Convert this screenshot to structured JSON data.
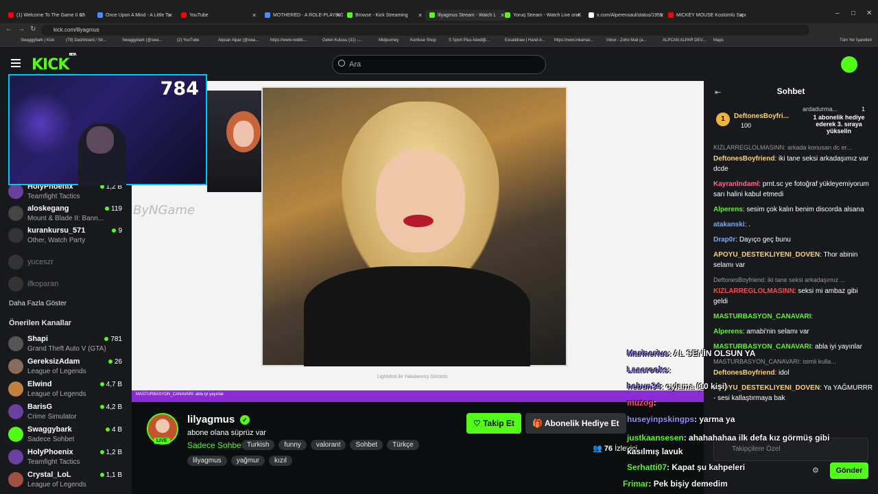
{
  "browser": {
    "tabs": [
      {
        "title": "(1) Welcome To The Game II Ch",
        "color": "#ff0000"
      },
      {
        "title": "Once Upon A Mind - A Little Ta",
        "color": "#4a8cff"
      },
      {
        "title": "YouTube",
        "color": "#ff0000"
      },
      {
        "title": "MOTHERED - A ROLE-PLAYING",
        "color": "#4a8cff"
      },
      {
        "title": "Browse - Kick Streaming",
        "color": "#53fc18"
      },
      {
        "title": "lilyagmus Stream - Watch L",
        "color": "#53fc18"
      },
      {
        "title": "Yoruq Stream - Watch Live on K",
        "color": "#53fc18"
      },
      {
        "title": "x.com/Alperensaul/status/1959",
        "color": "#ffffff"
      },
      {
        "title": "MICKEY MOUSE Kostümlü Sapı",
        "color": "#ff0000"
      }
    ],
    "url": "kick.com/lilyagmus",
    "bookmarks": [
      "Swaggybark | Kick",
      "(79) Dashboard / Str...",
      "Swaggybark (@swa...",
      "(2) YouTube",
      "Alpcan Alpar (@swa...",
      "https://www.reddit....",
      "Gelen Kutusu (31) -...",
      "Midjourney",
      "Konfuse Shop",
      "S Sport Plus-İstediği...",
      "Excalidraw | Hand-d...",
      "https://next.inkamat...",
      "Inbox - Zoho Mail (a...",
      "ALPCAN ALPAR DEV...",
      "Maps",
      "Tüm Yer İşaretleri"
    ]
  },
  "header": {
    "logo": "KICK",
    "logo_sup": "BETA",
    "search_placeholder": "Ara"
  },
  "sidebar": {
    "top_channels": [
      {
        "name": "HolyPhoenix",
        "game": "Teamfight Tactics",
        "viewers": "1,2 B",
        "color": "#6b3fa0"
      },
      {
        "name": "aloskegang",
        "game": "Mount & Blade II: Bann...",
        "viewers": "119",
        "color": "#444"
      },
      {
        "name": "kurankursu_571",
        "game": "Other, Watch Party",
        "viewers": "9",
        "color": "#333"
      }
    ],
    "offline": [
      "yuceszr",
      "ifkoparan"
    ],
    "show_more": "Daha Fazla Göster",
    "recommended_title": "Önerilen Kanallar",
    "recommended": [
      {
        "name": "Shapi",
        "game": "Grand Theft Auto V (GTA)",
        "viewers": "781",
        "color": "#555"
      },
      {
        "name": "GereksizAdam",
        "game": "League of Legends",
        "viewers": "26",
        "color": "#8a6a5a"
      },
      {
        "name": "Elwind",
        "game": "League of Legends",
        "viewers": "4,7 B",
        "color": "#c08040"
      },
      {
        "name": "BarisG",
        "game": "Crime Simulator",
        "viewers": "4,2 B",
        "color": "#6a3fa0"
      },
      {
        "name": "Swaggybark",
        "game": "Sadece Sohbet",
        "viewers": "4 B",
        "color": "#53fc18"
      },
      {
        "name": "HolyPhoenix",
        "game": "Teamfight Tactics",
        "viewers": "1,2 B",
        "color": "#6b3fa0"
      },
      {
        "name": "Crystal_LoL",
        "game": "League of Legends",
        "viewers": "1,1 B",
        "color": "#a05040"
      }
    ]
  },
  "webcam": {
    "count": "784"
  },
  "video": {
    "watermark": "ByNGame",
    "lightshot": "Lightshot ile Yakalanmış Görüntü",
    "purple_bar": "MASTURBASYON_CANAVARI: abla iyi yayınlar"
  },
  "stream": {
    "name": "lilyagmus",
    "title": "abone olana süprüz var",
    "category": "Sadece Sohbet",
    "tags": [
      "Turkish",
      "funny",
      "valorant",
      "Sohbet",
      "Türkçe"
    ],
    "tags2": [
      "lilyagmus",
      "yağmur",
      "kızıl"
    ],
    "follow": "Takip Et",
    "gift_sub": "Abonelik Hediye Et",
    "viewers": "76",
    "viewers_label": "İzleyici",
    "live": "LIVE"
  },
  "chat": {
    "title": "Sohbet",
    "gift": {
      "user": "DeftonesBoyfri...",
      "count": "100",
      "user2": "ardadurma...",
      "count2": "1",
      "text": "1 abonelik hediye ederek 3. sıraya yükselin"
    },
    "messages": [
      {
        "reply": "KIZLARREGLOLMASINN: arkada konusan dc er..."
      },
      {
        "user": "DeftonesBoyfriend",
        "color": "#ffd36a",
        "text": "iki tane seksi arkadaşımız var dcde"
      },
      {
        "user": "Kayranlndaml",
        "color": "#ff6a8a",
        "text": "prnt.sc ye fotoğraf yükleyemiyorum sarı halini kabul etmedi"
      },
      {
        "user": "Alperens",
        "color": "#53fc18",
        "text": "sesim çok kalın benim discorda alsana"
      },
      {
        "user": "atakanski",
        "color": "#7aa8ff",
        "text": "."
      },
      {
        "user": "Drap0r",
        "color": "#7aa8ff",
        "text": "Dayıço geç bunu"
      },
      {
        "user": "APOYU_DESTEKLIYENI_DOVEN",
        "color": "#ffd36a",
        "text": "Thor abinin selamı var"
      },
      {
        "reply": "DeftonesBoyfriend: iki tane seksi arkadaşımız ..."
      },
      {
        "user": "KIZLARREGLOLMASINN",
        "color": "#ff4a4a",
        "text": "seksi mi ambaz gibi geldi"
      },
      {
        "user": "MASTURBASYON_CANAVARI",
        "color": "#53fc18",
        "text": ""
      },
      {
        "user": "Alperens",
        "color": "#53fc18",
        "text": "amabi'nin selamı var"
      },
      {
        "user": "MASTURBASYON_CANAVARI",
        "color": "#53fc18",
        "text": "abla iyi yayınlar"
      },
      {
        "reply": "MASTURBASYON_CANAVARI: isimli kulla..."
      },
      {
        "user": "DeftonesBoyfriend",
        "color": "#ffd36a",
        "text": "idol"
      },
      {
        "user": "APOYU_DESTEKLIYENI_DOVEN",
        "color": "#ffd36a",
        "text": "Ya YAĞMURRR - sesi kallaştırmaya bak"
      }
    ],
    "input_placeholder": "Takipçilere Özel",
    "send": "Gönder"
  },
  "overlay_chat": [
    {
      "user": "Marinerius",
      "text": ": AL SENİN OLSUN YA"
    },
    {
      "user": "Laacrooks",
      "text": ":"
    },
    {
      "user": "hebun34",
      "text": ": oylama (10 kişi)"
    },
    {
      "user": "muzog",
      "text": ":"
    },
    {
      "user": "huseyinpskingps",
      "text": ": yarma ya"
    },
    {
      "user": "justkaansesen",
      "text": ": ahahahahaa ilk defa kız görmüş gibi kasılmış lavuk"
    },
    {
      "user": "Serhatti07",
      "text": ": Kapat şu kahpeleri"
    },
    {
      "user": "Frimar",
      "text": ": Pek bişiy demedim"
    }
  ]
}
